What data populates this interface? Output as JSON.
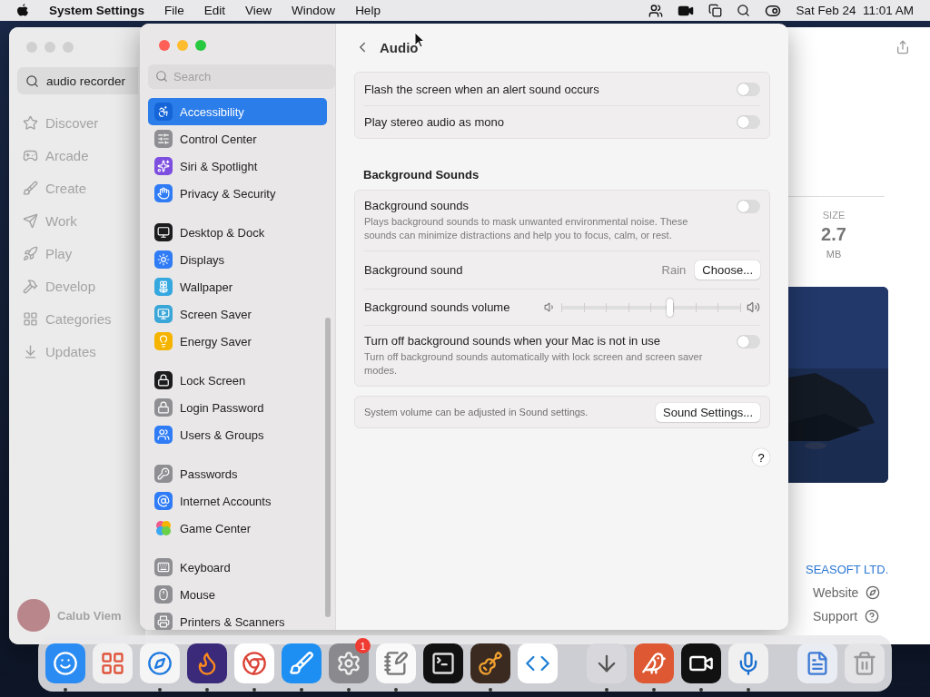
{
  "menubar": {
    "app": "System Settings",
    "menus": [
      "File",
      "Edit",
      "View",
      "Window",
      "Help"
    ],
    "clock": "Sat Feb 24  11:01 AM"
  },
  "app_store": {
    "search": {
      "value": "audio recorder"
    },
    "nav": [
      "Discover",
      "Arcade",
      "Create",
      "Work",
      "Play",
      "Develop",
      "Categories",
      "Updates"
    ],
    "user": "Calub Viem",
    "size": {
      "label": "SIZE",
      "value": "2.7",
      "unit": "MB"
    },
    "developer": "SEASOFT LTD.",
    "links": [
      "Website",
      "Support"
    ]
  },
  "settings": {
    "search": {
      "placeholder": "Search"
    },
    "sidebar": [
      [
        {
          "label": "Accessibility",
          "selected": true
        },
        {
          "label": "Control Center",
          "selected": false
        },
        {
          "label": "Siri & Spotlight",
          "selected": false
        },
        {
          "label": "Privacy & Security",
          "selected": false
        }
      ],
      [
        {
          "label": "Desktop & Dock",
          "selected": false
        },
        {
          "label": "Displays",
          "selected": false
        },
        {
          "label": "Wallpaper",
          "selected": false
        },
        {
          "label": "Screen Saver",
          "selected": false
        },
        {
          "label": "Energy Saver",
          "selected": false
        }
      ],
      [
        {
          "label": "Lock Screen",
          "selected": false
        },
        {
          "label": "Login Password",
          "selected": false
        },
        {
          "label": "Users & Groups",
          "selected": false
        }
      ],
      [
        {
          "label": "Passwords",
          "selected": false
        },
        {
          "label": "Internet Accounts",
          "selected": false
        },
        {
          "label": "Game Center",
          "selected": false
        }
      ],
      [
        {
          "label": "Keyboard",
          "selected": false
        },
        {
          "label": "Mouse",
          "selected": false
        },
        {
          "label": "Printers & Scanners",
          "selected": false
        }
      ]
    ],
    "title": "Audio",
    "cards": [
      {
        "rows": [
          {
            "kind": "toggle",
            "label": "Flash the screen when an alert sound occurs",
            "on": false
          },
          {
            "kind": "toggle",
            "label": "Play stereo audio as mono",
            "on": false
          }
        ]
      },
      {
        "heading": "Background Sounds",
        "rows": [
          {
            "kind": "toggle",
            "label": "Background sounds",
            "description": "Plays background sounds to mask unwanted environmental noise. These sounds can minimize distractions and help you to focus, calm, or rest.",
            "on": false
          },
          {
            "kind": "choose",
            "label": "Background sound",
            "value": "Rain",
            "button": "Choose..."
          },
          {
            "kind": "slider",
            "label": "Background sounds volume",
            "level": 0.6
          },
          {
            "kind": "toggle",
            "label": "Turn off background sounds when your Mac is not in use",
            "description": "Turn off background sounds automatically with lock screen and screen saver modes.",
            "on": false
          }
        ]
      },
      {
        "rows": [
          {
            "kind": "note",
            "label": "System volume can be adjusted in Sound settings.",
            "button": "Sound Settings..."
          }
        ]
      }
    ],
    "help": "?"
  },
  "dock": [
    [
      {
        "running": true
      },
      {
        "running": false
      },
      {
        "running": true
      },
      {
        "running": true
      },
      {
        "running": true
      },
      {
        "running": true
      },
      {
        "running": true,
        "badge": "1"
      },
      {
        "running": true
      },
      {
        "running": false
      },
      {
        "running": true
      },
      {
        "running": false
      }
    ],
    [
      {
        "running": true
      },
      {
        "running": true
      },
      {
        "running": true
      },
      {
        "running": true
      }
    ],
    [
      {
        "running": false
      },
      {
        "running": false
      }
    ]
  ]
}
